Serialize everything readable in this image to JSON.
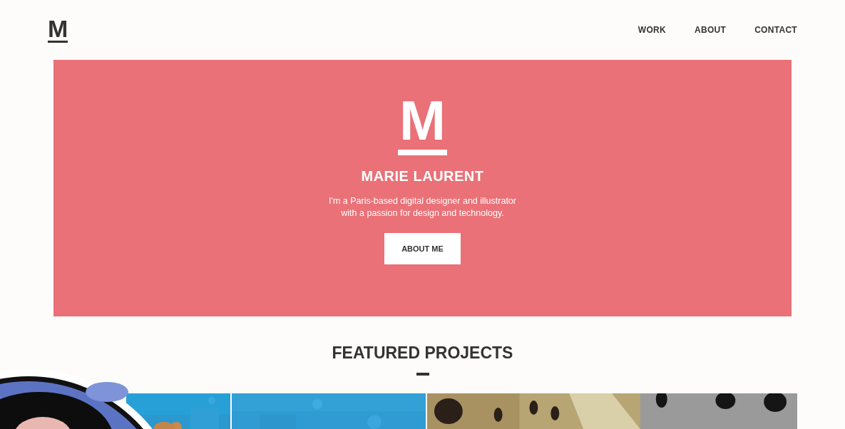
{
  "header": {
    "logo": "M",
    "nav": [
      {
        "label": "WORK"
      },
      {
        "label": "ABOUT"
      },
      {
        "label": "CONTACT"
      }
    ]
  },
  "hero": {
    "logo": "M",
    "name": "MARIE LAURENT",
    "intro_lines": [
      "I'm a Paris-based digital designer and illustrator",
      "with a passion for design and technology."
    ],
    "button": "ABOUT ME"
  },
  "featured": {
    "title": "FEATURED PROJECTS"
  }
}
